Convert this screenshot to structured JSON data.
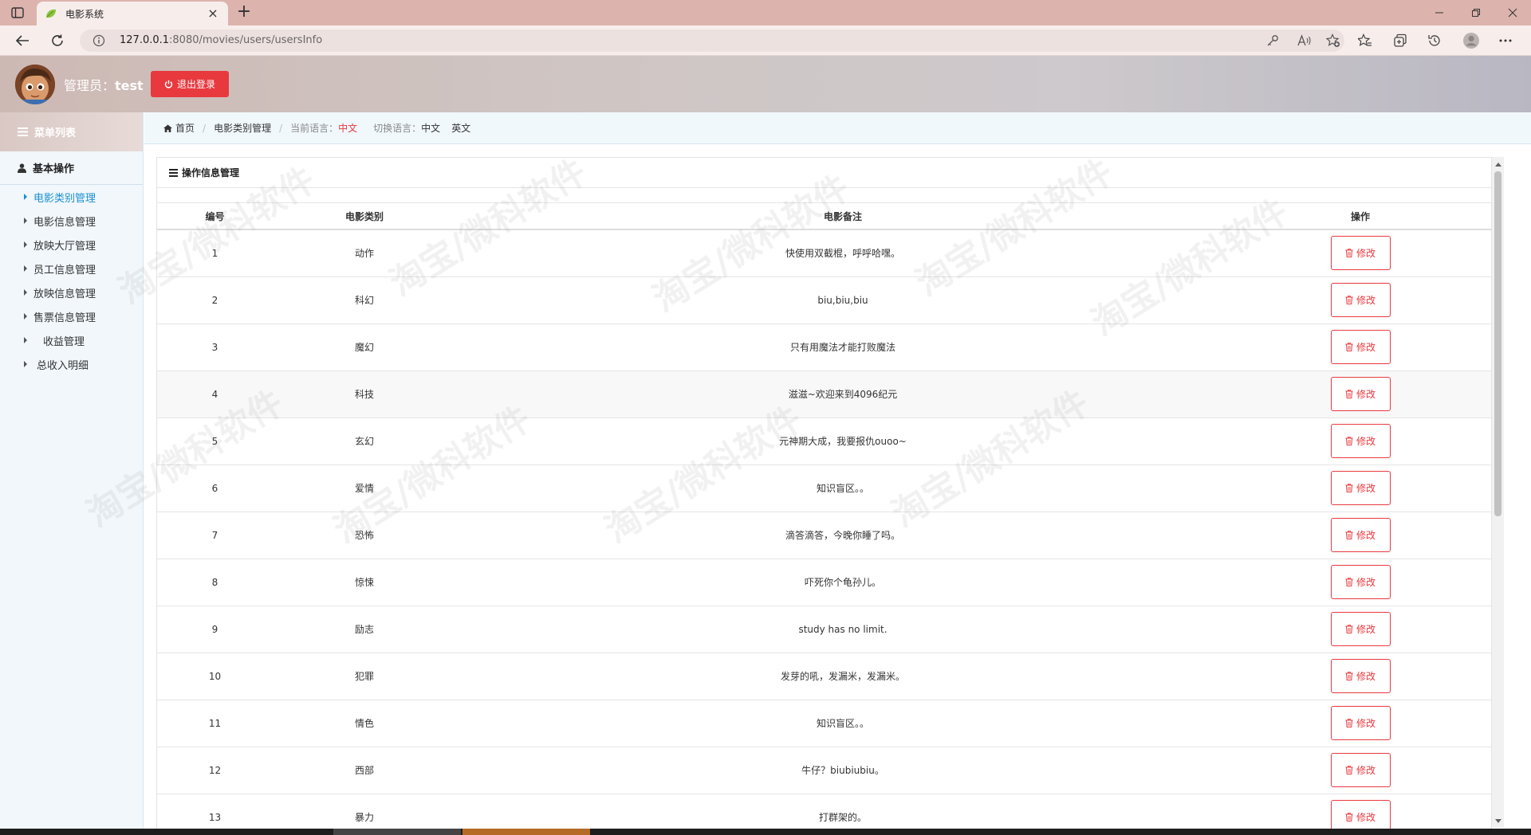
{
  "browser": {
    "tab_title": "电影系统",
    "url_host": "127.0.0.1",
    "url_rest": ":8080/movies/users/usersInfo"
  },
  "header": {
    "admin_label": "管理员：",
    "admin_name": "test",
    "logout_label": "退出登录"
  },
  "sidebar": {
    "menu_title": "菜单列表",
    "group_title": "基本操作",
    "items": [
      {
        "label": "电影类别管理"
      },
      {
        "label": "电影信息管理"
      },
      {
        "label": "放映大厅管理"
      },
      {
        "label": "员工信息管理"
      },
      {
        "label": "放映信息管理"
      },
      {
        "label": "售票信息管理"
      },
      {
        "label": "收益管理"
      },
      {
        "label": "总收入明细"
      }
    ]
  },
  "breadcrumb": {
    "home": "首页",
    "current": "电影类别管理",
    "lang_label": "当前语言：",
    "lang_value": "中文",
    "switch_label": "切换语言：",
    "lang_zh": "中文",
    "lang_en": "英文"
  },
  "panel": {
    "title": "操作信息管理"
  },
  "table": {
    "headers": [
      "编号",
      "电影类别",
      "电影备注",
      "操作"
    ],
    "edit_label": "修改",
    "rows": [
      {
        "id": "1",
        "category": "动作",
        "note": "快使用双截棍，呼呼哈嘿。"
      },
      {
        "id": "2",
        "category": "科幻",
        "note": "biu,biu,biu"
      },
      {
        "id": "3",
        "category": "魔幻",
        "note": "只有用魔法才能打败魔法"
      },
      {
        "id": "4",
        "category": "科技",
        "note": "滋滋~欢迎来到4096纪元"
      },
      {
        "id": "5",
        "category": "玄幻",
        "note": "元神期大成，我要报仇ouoo~"
      },
      {
        "id": "6",
        "category": "爱情",
        "note": "知识盲区。。"
      },
      {
        "id": "7",
        "category": "恐怖",
        "note": "滴答滴答，今晚你睡了吗。"
      },
      {
        "id": "8",
        "category": "惊悚",
        "note": "吓死你个龟孙儿。"
      },
      {
        "id": "9",
        "category": "励志",
        "note": "study has no limit."
      },
      {
        "id": "10",
        "category": "犯罪",
        "note": "发芽的吼，发漏米，发漏米。"
      },
      {
        "id": "11",
        "category": "情色",
        "note": "知识盲区。。"
      },
      {
        "id": "12",
        "category": "西部",
        "note": "牛仔？biubiubiu。"
      },
      {
        "id": "13",
        "category": "暴力",
        "note": "打群架的。"
      }
    ]
  },
  "watermark": "淘宝/微科软件"
}
